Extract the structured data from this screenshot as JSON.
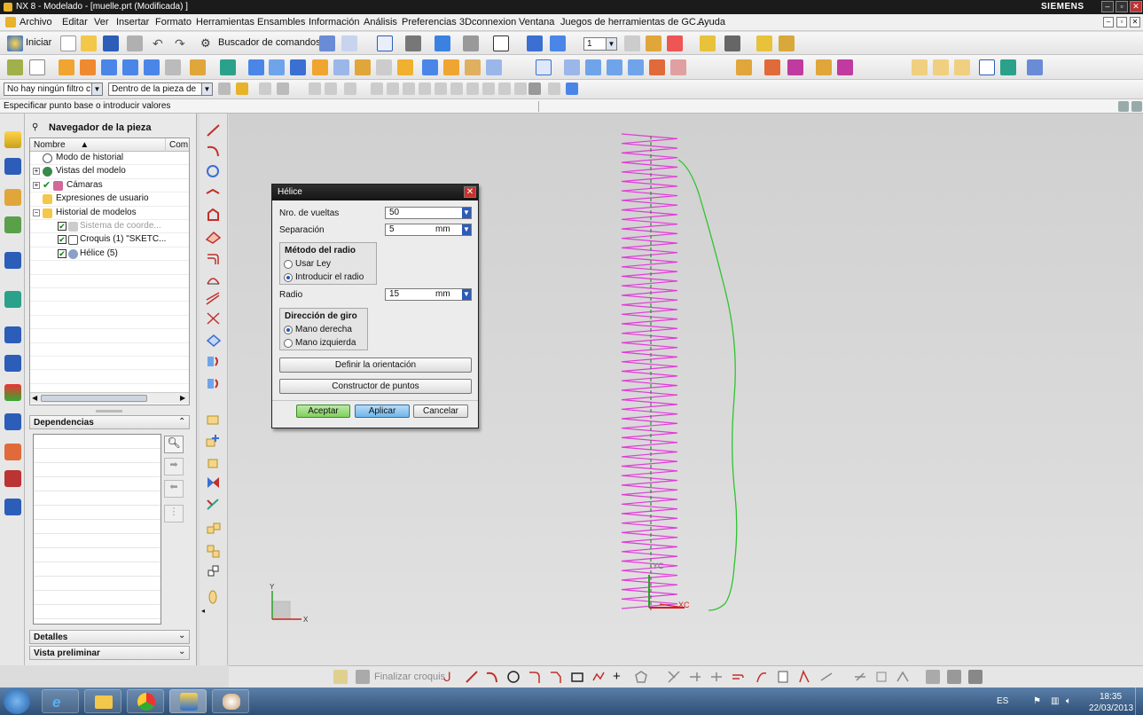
{
  "window": {
    "title": "NX 8 - Modelado - [muelle.prt (Modificada) ]",
    "brand": "SIEMENS"
  },
  "menu": [
    "Archivo",
    "Editar",
    "Ver",
    "Insertar",
    "Formato",
    "Herramientas",
    "Ensambles",
    "Información",
    "Análisis",
    "Preferencias",
    "3Dconnexion",
    "Ventana",
    "Juegos de herramientas de GC...",
    "Ayuda"
  ],
  "toolbar1": {
    "start_label": "Iniciar",
    "command_finder_label": "Buscador de comandos",
    "layer_value": "1"
  },
  "selection_bar": {
    "filter_value": "No hay ningún filtro c",
    "scope_value": "Dentro de la pieza de"
  },
  "status": {
    "prompt": "Especificar punto base o introducir valores"
  },
  "navigator": {
    "title": "Navegador de la pieza",
    "col_name": "Nombre",
    "col_comment": "Com",
    "rows": [
      "Modo de historial",
      "Vistas del modelo",
      "Cámaras",
      "Expresiones de usuario",
      "Historial de modelos",
      "Sistema de coorde...",
      "Croquis (1) \"SKETC...",
      "Hélice (5)"
    ],
    "dependencies_title": "Dependencias",
    "details_title": "Detalles",
    "preview_title": "Vista preliminar"
  },
  "dialog": {
    "title": "Hélice",
    "turns_label": "Nro. de vueltas",
    "turns_value": "50",
    "pitch_label": "Separación",
    "pitch_value": "5",
    "pitch_unit": "mm",
    "radius_method_title": "Método del radio",
    "radius_method_options": [
      "Usar Ley",
      "Introducir el radio"
    ],
    "radius_method_selected": "Introducir el radio",
    "radius_label": "Radio",
    "radius_value": "15",
    "radius_unit": "mm",
    "direction_title": "Dirección de giro",
    "direction_options": [
      "Mano derecha",
      "Mano izquierda"
    ],
    "direction_selected": "Mano derecha",
    "orientation_button": "Definir la orientación",
    "point_builder_button": "Constructor de puntos",
    "ok_button": "Aceptar",
    "apply_button": "Aplicar",
    "cancel_button": "Cancelar"
  },
  "graphics": {
    "wcs_x": "XC",
    "wcs_y": "YC",
    "triad_x": "X",
    "triad_y": "Y",
    "helix_color": "#e23ad9",
    "curve_color": "#2ec42e"
  },
  "sketch_toolbar": {
    "finish_sketch_label": "Finalizar croquis"
  },
  "taskbar": {
    "lang": "ES",
    "time": "18:35",
    "date": "22/03/2013"
  }
}
